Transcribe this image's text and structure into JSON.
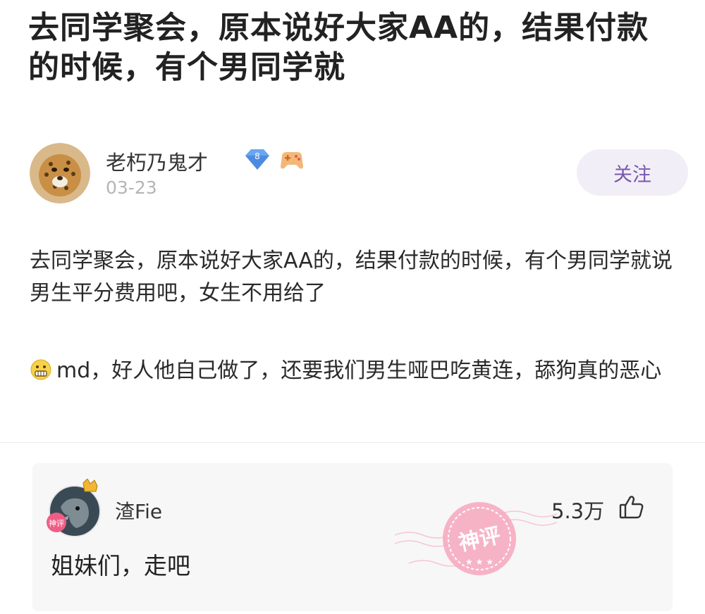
{
  "post": {
    "title": "去同学聚会，原本说好大家AA的，结果付款的时候，有个男同学就",
    "author": {
      "name": "老朽乃鬼才",
      "level": "8",
      "date": "03-23"
    },
    "follow_label": "关注",
    "paragraphs": [
      "去同学聚会，原本说好大家AA的，结果付款的时候，有个男同学就说男生平分费用吧，女生不用给了",
      "md，好人他自己做了，还要我们男生哑巴吃黄连，舔狗真的恶心"
    ]
  },
  "comment": {
    "user": "渣Fie",
    "likes": "5.3万",
    "text": "姐妹们，走吧",
    "stamp_text": "神评",
    "avatar_tag": "神评"
  },
  "icons": {
    "badge": "level-diamond-icon",
    "emoji": "game-controller-icon",
    "inline_emoji": "grimace-emoji-icon",
    "like": "thumbs-up-icon",
    "crown": "crown-icon"
  },
  "colors": {
    "follow_bg": "#f2eef7",
    "follow_text": "#7a57b0",
    "date": "#b5b5b5",
    "stamp": "#f28aa8"
  }
}
